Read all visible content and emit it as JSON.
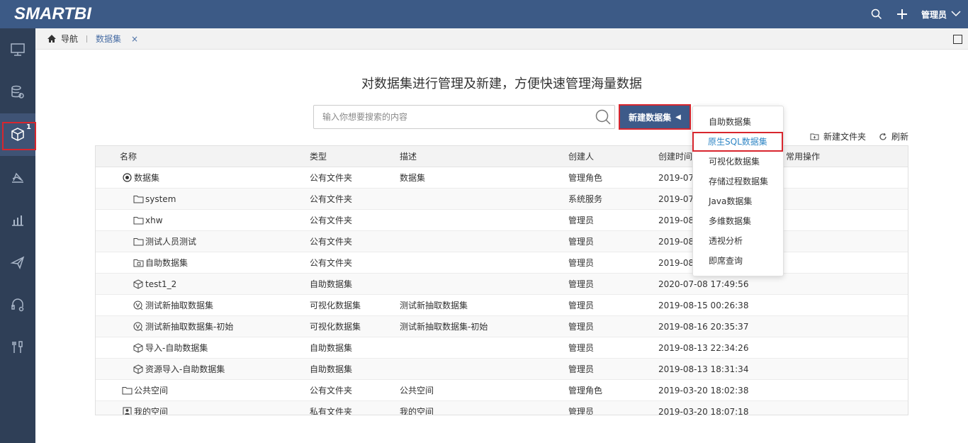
{
  "app": {
    "logo": "SMARTBI",
    "user": "管理员"
  },
  "colors": {
    "topbar": "#3c5a86",
    "sidebar": "#2f3f57",
    "accent": "#3d5a89",
    "highlight_border": "#d8262e",
    "link": "#2f86c5"
  },
  "sidebar": {
    "items": [
      {
        "icon": "monitor-icon"
      },
      {
        "icon": "database-gear-icon"
      },
      {
        "icon": "cube-icon",
        "badge": "1",
        "active": true
      },
      {
        "icon": "analysis-icon"
      },
      {
        "icon": "bar-chart-icon"
      },
      {
        "icon": "paper-plane-icon"
      },
      {
        "icon": "headset-icon"
      },
      {
        "icon": "tools-icon"
      }
    ]
  },
  "tabs": {
    "home": "导航",
    "active": "数据集",
    "close": "×"
  },
  "main": {
    "headline": "对数据集进行管理及新建，方便快速管理海量数据",
    "search_placeholder": "输入你想要搜索的内容",
    "new_button": "新建数据集",
    "new_folder": "新建文件夹",
    "refresh": "刷新"
  },
  "table": {
    "headers": [
      "名称",
      "类型",
      "描述",
      "创建人",
      "创建时间",
      "常用操作"
    ],
    "rows": [
      {
        "name": "数据集",
        "icon": "radio-icon",
        "indent": 0,
        "type": "公有文件夹",
        "desc": "数据集",
        "creator": "管理角色",
        "time": "2019-07"
      },
      {
        "name": "system",
        "icon": "folder-icon",
        "indent": 1,
        "type": "公有文件夹",
        "desc": "",
        "creator": "系统服务",
        "time": "2019-07"
      },
      {
        "name": "xhw",
        "icon": "folder-icon",
        "indent": 1,
        "type": "公有文件夹",
        "desc": "",
        "creator": "管理员",
        "time": "2019-08"
      },
      {
        "name": "测试人员测试",
        "icon": "folder-icon",
        "indent": 1,
        "type": "公有文件夹",
        "desc": "",
        "creator": "管理员",
        "time": "2019-08"
      },
      {
        "name": "自助数据集",
        "icon": "folder-dataset-icon",
        "indent": 1,
        "type": "公有文件夹",
        "desc": "",
        "creator": "管理员",
        "time": "2019-08"
      },
      {
        "name": "test1_2",
        "icon": "cube-icon",
        "indent": 1,
        "type": "自助数据集",
        "desc": "",
        "creator": "管理员",
        "time": "2020-07-08 17:49:56"
      },
      {
        "name": "测试新抽取数据集",
        "icon": "visual-dataset-icon",
        "indent": 1,
        "type": "可视化数据集",
        "desc": "测试新抽取数据集",
        "creator": "管理员",
        "time": "2019-08-15 00:26:38"
      },
      {
        "name": "测试新抽取数据集-初始",
        "icon": "visual-dataset-icon",
        "indent": 1,
        "type": "可视化数据集",
        "desc": "测试新抽取数据集-初始",
        "creator": "管理员",
        "time": "2019-08-16 20:35:37"
      },
      {
        "name": "导入-自助数据集",
        "icon": "cube-icon",
        "indent": 1,
        "type": "自助数据集",
        "desc": "",
        "creator": "管理员",
        "time": "2019-08-13 22:34:26"
      },
      {
        "name": "资源导入-自助数据集",
        "icon": "cube-icon",
        "indent": 1,
        "type": "自助数据集",
        "desc": "",
        "creator": "管理员",
        "time": "2019-08-13 18:31:34"
      },
      {
        "name": "公共空间",
        "icon": "folder-icon",
        "indent": 0,
        "type": "公有文件夹",
        "desc": "公共空间",
        "creator": "管理角色",
        "time": "2019-03-20 18:02:38"
      },
      {
        "name": "我的空间",
        "icon": "user-card-icon",
        "indent": 0,
        "type": "私有文件夹",
        "desc": "我的空间",
        "creator": "管理员",
        "time": "2019-03-20 18:07:18"
      }
    ]
  },
  "dropdown": {
    "items": [
      "自助数据集",
      "原生SQL数据集",
      "可视化数据集",
      "存储过程数据集",
      "Java数据集",
      "多维数据集",
      "透视分析",
      "即席查询"
    ],
    "highlighted": "原生SQL数据集"
  }
}
